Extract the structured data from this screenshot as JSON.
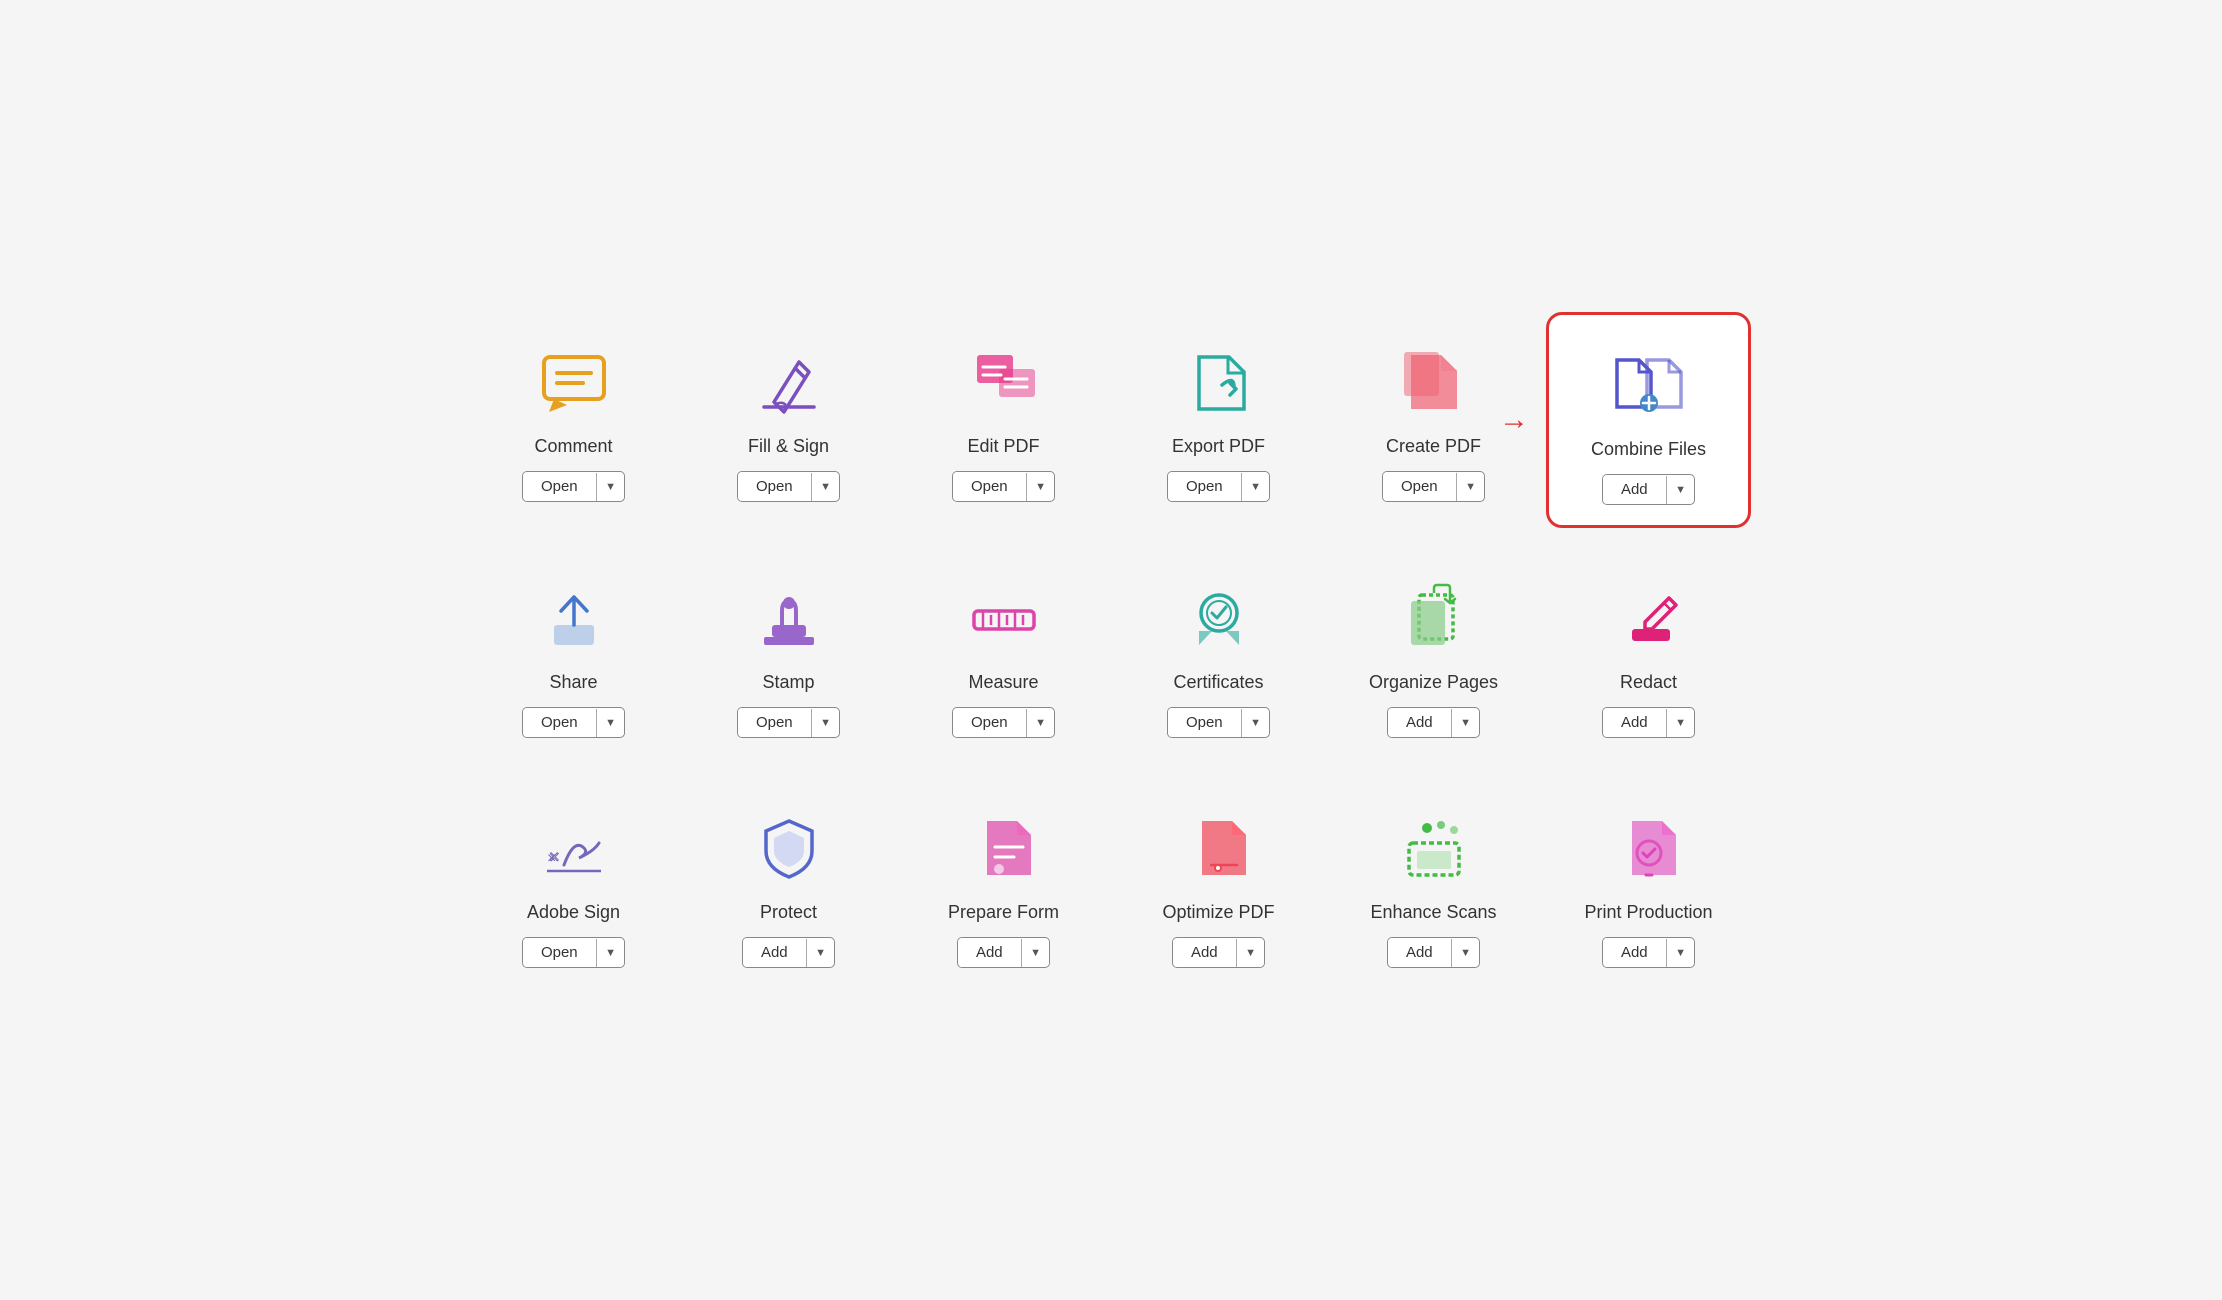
{
  "tools": [
    {
      "id": "comment",
      "label": "Comment",
      "button": "Open",
      "highlighted": false,
      "icon": "comment"
    },
    {
      "id": "fill-sign",
      "label": "Fill & Sign",
      "button": "Open",
      "highlighted": false,
      "icon": "fill-sign"
    },
    {
      "id": "edit-pdf",
      "label": "Edit PDF",
      "button": "Open",
      "highlighted": false,
      "icon": "edit-pdf"
    },
    {
      "id": "export-pdf",
      "label": "Export PDF",
      "button": "Open",
      "highlighted": false,
      "icon": "export-pdf"
    },
    {
      "id": "create-pdf",
      "label": "Create PDF",
      "button": "Open",
      "highlighted": false,
      "icon": "create-pdf"
    },
    {
      "id": "combine-files",
      "label": "Combine Files",
      "button": "Add",
      "highlighted": true,
      "icon": "combine-files"
    },
    {
      "id": "share",
      "label": "Share",
      "button": "Open",
      "highlighted": false,
      "icon": "share"
    },
    {
      "id": "stamp",
      "label": "Stamp",
      "button": "Open",
      "highlighted": false,
      "icon": "stamp"
    },
    {
      "id": "measure",
      "label": "Measure",
      "button": "Open",
      "highlighted": false,
      "icon": "measure"
    },
    {
      "id": "certificates",
      "label": "Certificates",
      "button": "Open",
      "highlighted": false,
      "icon": "certificates"
    },
    {
      "id": "organize-pages",
      "label": "Organize Pages",
      "button": "Add",
      "highlighted": false,
      "icon": "organize-pages"
    },
    {
      "id": "redact",
      "label": "Redact",
      "button": "Add",
      "highlighted": false,
      "icon": "redact"
    },
    {
      "id": "adobe-sign",
      "label": "Adobe Sign",
      "button": "Open",
      "highlighted": false,
      "icon": "adobe-sign"
    },
    {
      "id": "protect",
      "label": "Protect",
      "button": "Add",
      "highlighted": false,
      "icon": "protect"
    },
    {
      "id": "prepare-form",
      "label": "Prepare Form",
      "button": "Add",
      "highlighted": false,
      "icon": "prepare-form"
    },
    {
      "id": "optimize-pdf",
      "label": "Optimize PDF",
      "button": "Add",
      "highlighted": false,
      "icon": "optimize-pdf"
    },
    {
      "id": "enhance-scans",
      "label": "Enhance Scans",
      "button": "Add",
      "highlighted": false,
      "icon": "enhance-scans"
    },
    {
      "id": "print-production",
      "label": "Print Production",
      "button": "Add",
      "highlighted": false,
      "icon": "print-production"
    }
  ]
}
